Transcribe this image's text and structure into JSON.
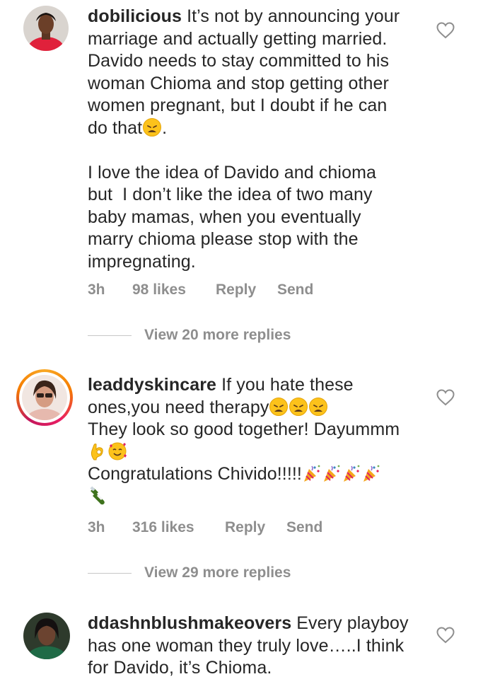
{
  "comments": [
    {
      "username": "dobilicious",
      "text_line1": " It’s not by announcing your",
      "text_rest1": "marriage and actually getting married.\nDavido needs to stay committed to his\nwoman Chioma and stop getting other\nwomen pregnant, but I doubt if he can\ndo that",
      "text_after_emoji": ".",
      "text_rest2": "\n\nI love the idea of Davido and chioma\nbut  I don’t like the idea of two many\nbaby mamas, when you eventually\nmarry chioma please stop with the\nimpregnating.",
      "time": "3h",
      "likes": "98 likes",
      "reply": "Reply",
      "send": "Send",
      "view_more": "View 20 more replies",
      "emoji": "weary-face"
    },
    {
      "username": "leaddyskincare",
      "text_line1": " If you hate these",
      "text_line2a": "ones,you need therapy",
      "text_line3": "They look so good together! Dayummm",
      "text_line5": "Congratulations Chivido!!!!!",
      "time": "3h",
      "likes": "316 likes",
      "reply": "Reply",
      "send": "Send",
      "view_more": "View 29 more replies",
      "emojis_line2": [
        "weary-face",
        "weary-face",
        "weary-face"
      ],
      "emojis_line4": [
        "ok-hand",
        "smiling-face-with-hearts"
      ],
      "emojis_line5": [
        "party-popper",
        "party-popper",
        "party-popper",
        "party-popper"
      ],
      "emojis_line6": [
        "champagne-bottle"
      ]
    },
    {
      "username": "ddashnblushmakeovers",
      "text_line1": " Every playboy",
      "text_rest": "has one woman they truly love…..I think\nfor Davido, it’s Chioma."
    }
  ]
}
